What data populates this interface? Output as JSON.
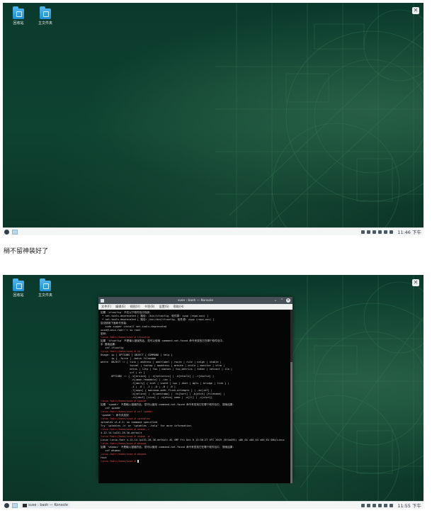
{
  "top": {
    "desktop_icons": [
      {
        "label": "回收站"
      },
      {
        "label": "主文件夹"
      }
    ],
    "clock": "11:46 下午"
  },
  "caption": "稍不留神装好了",
  "bottom": {
    "desktop_icons": [
      {
        "label": "回收站"
      },
      {
        "label": "主文件夹"
      }
    ],
    "window": {
      "title": "suse : bash — Konsole",
      "menus": [
        "文件(F)",
        "编辑(E)",
        "视图(V)",
        "书签(B)",
        "设置(S)",
        "帮助(H)"
      ]
    },
    "terminal_lines": [
      {
        "t": "如果 'ifconfig' 不在以下软件包中找到：",
        "c": ""
      },
      {
        "t": " * net-tools-deprecated [ 路径: /bin/ifconfig, 软件源: zypp (repo-oss) ]",
        "c": ""
      },
      {
        "t": " * net-tools-deprecated [ 路径: /usr/bin/ifconfig, 软件源: zypp (repo-oss) ]",
        "c": ""
      },
      {
        "t": "",
        "c": ""
      },
      {
        "t": "尝试使用下面命令安装：",
        "c": ""
      },
      {
        "t": "   sudo zypper install net-tools-deprecated",
        "c": ""
      },
      {
        "t": "",
        "c": ""
      },
      {
        "t": "suse@linux-fodr:~> su root",
        "c": ""
      },
      {
        "t": "密码：",
        "c": ""
      },
      {
        "t": "linux-fodr:/home/suse # ifconfig",
        "c": "red"
      },
      {
        "t": "如果 'ifconfig' 不是输入错误的话, 您可以使用 command-not-found 命令来查找它在哪个软件包中,",
        "c": ""
      },
      {
        "t": "手 搜索结果：",
        "c": ""
      },
      {
        "t": "   cnf ifconfig",
        "c": ""
      },
      {
        "t": "linux-fodr:/home/suse # ip",
        "c": "red"
      },
      {
        "t": "Usage: ip [ OPTIONS ] OBJECT { COMMAND | help }",
        "c": ""
      },
      {
        "t": "       ip [ -force ] -batch filename",
        "c": ""
      },
      {
        "t": "where  OBJECT := { link | address | addrlabel | route | rule | neigh | ntable |",
        "c": ""
      },
      {
        "t": "                   tunnel | tuntap | maddress | mroute | mrule | monitor | xfrm |",
        "c": ""
      },
      {
        "t": "                   netns | l2tp | fou | macsec | tcp_metrics | token | netconf | ila |",
        "c": ""
      },
      {
        "t": "                   vrf | sr }",
        "c": ""
      },
      {
        "t": "       OPTIONS := { -V[ersion] | -s[tatistics] | -d[etails] | -r[esolve] |",
        "c": ""
      },
      {
        "t": "                    -h[uman-readable] | -iec |",
        "c": ""
      },
      {
        "t": "                    -f[amily] { inet | inet6 | ipx | dnet | mpls | bridge | link } |",
        "c": ""
      },
      {
        "t": "                    -4 | -6 | -I | -D | -B | -0 |",
        "c": ""
      },
      {
        "t": "                    -l[oops] { maximum-addr-flush-attempts } | -br[ief] |",
        "c": ""
      },
      {
        "t": "                    -o[neline] | -t[imestamp] | -ts[hort] | -b[atch] [filename] |",
        "c": ""
      },
      {
        "t": "                    -rc[vbuf] [size] | -n[etns] name | -a[ll] | -c[olor]}",
        "c": ""
      },
      {
        "t": "linux-fodr:/home/suse # ipaddr",
        "c": "red"
      },
      {
        "t": "如果 'ipaddr' 不是输入错误的话, 您可以使用 command-not-found 命令来查找它在哪个软件包中, 搜索结果：",
        "c": ""
      },
      {
        "t": "   cnf ipaddr",
        "c": ""
      },
      {
        "t": "linux-fodr:/home/suse # cnf ipaddr",
        "c": "red"
      },
      {
        "t": "'ipaddr': 命令未找到",
        "c": ""
      },
      {
        "t": "linux-fodr:/home/suse # iptables",
        "c": "red"
      },
      {
        "t": "iptables v1.6.2: no command specified",
        "c": ""
      },
      {
        "t": "Try `iptables -h' or 'iptables --help' for more information.",
        "c": ""
      },
      {
        "t": "linux-fodr:/home/suse # uname -r",
        "c": "red"
      },
      {
        "t": "4.12.14-lp151.28.36-default",
        "c": ""
      },
      {
        "t": "linux-fodr:/home/suse # uname -a",
        "c": "red"
      },
      {
        "t": "Linux linux-fodr 4.12.14-lp151.28.36-default #1 SMP Fri Dec 6 13:50:27 UTC 2019 (8f4a495) x86_64 x86_64 x86_64 GNU/Linux",
        "c": ""
      },
      {
        "t": "linux-fodr:/home/suse # whomai",
        "c": "red"
      },
      {
        "t": "如果 'whomai' 不是输入错误的话, 您可以使用 command-not-found 命令来查找它在哪个软件包中, 搜索结果：",
        "c": ""
      },
      {
        "t": "   cnf whomai",
        "c": ""
      },
      {
        "t": "linux-fodr:/home/suse # whoami",
        "c": "red"
      },
      {
        "t": "root",
        "c": ""
      },
      {
        "t": "linux-fodr:/home/suse # ",
        "c": "red"
      }
    ],
    "taskbar_task": "suse : bash — Konsole",
    "clock": "11:55 下午"
  }
}
